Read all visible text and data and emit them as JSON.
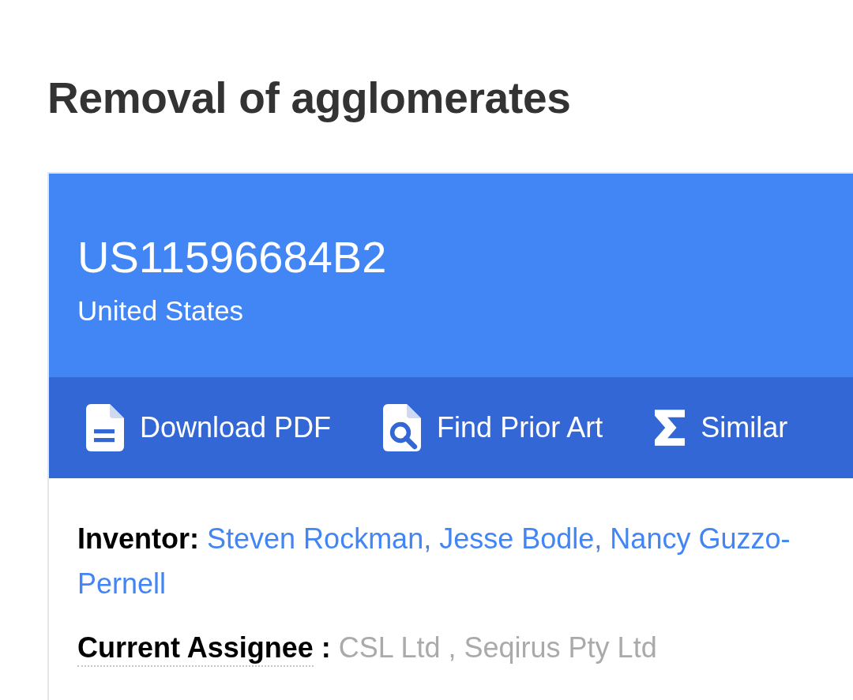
{
  "title": "Removal of agglomerates",
  "patent": {
    "number": "US11596684B2",
    "country": "United States"
  },
  "actions": [
    {
      "kind": "pdf",
      "label": "Download PDF"
    },
    {
      "kind": "prior_art",
      "label": "Find Prior Art"
    },
    {
      "kind": "similar",
      "label": "Similar"
    }
  ],
  "inventor": {
    "label": "Inventor:",
    "separator": ",",
    "names": [
      "Steven Rockman",
      "Jesse Bodle",
      "Nancy Guzzo-Pernell"
    ]
  },
  "assignee": {
    "label": "Current Assignee",
    "colon": ":",
    "value": "CSL Ltd , Seqirus Pty Ltd"
  }
}
